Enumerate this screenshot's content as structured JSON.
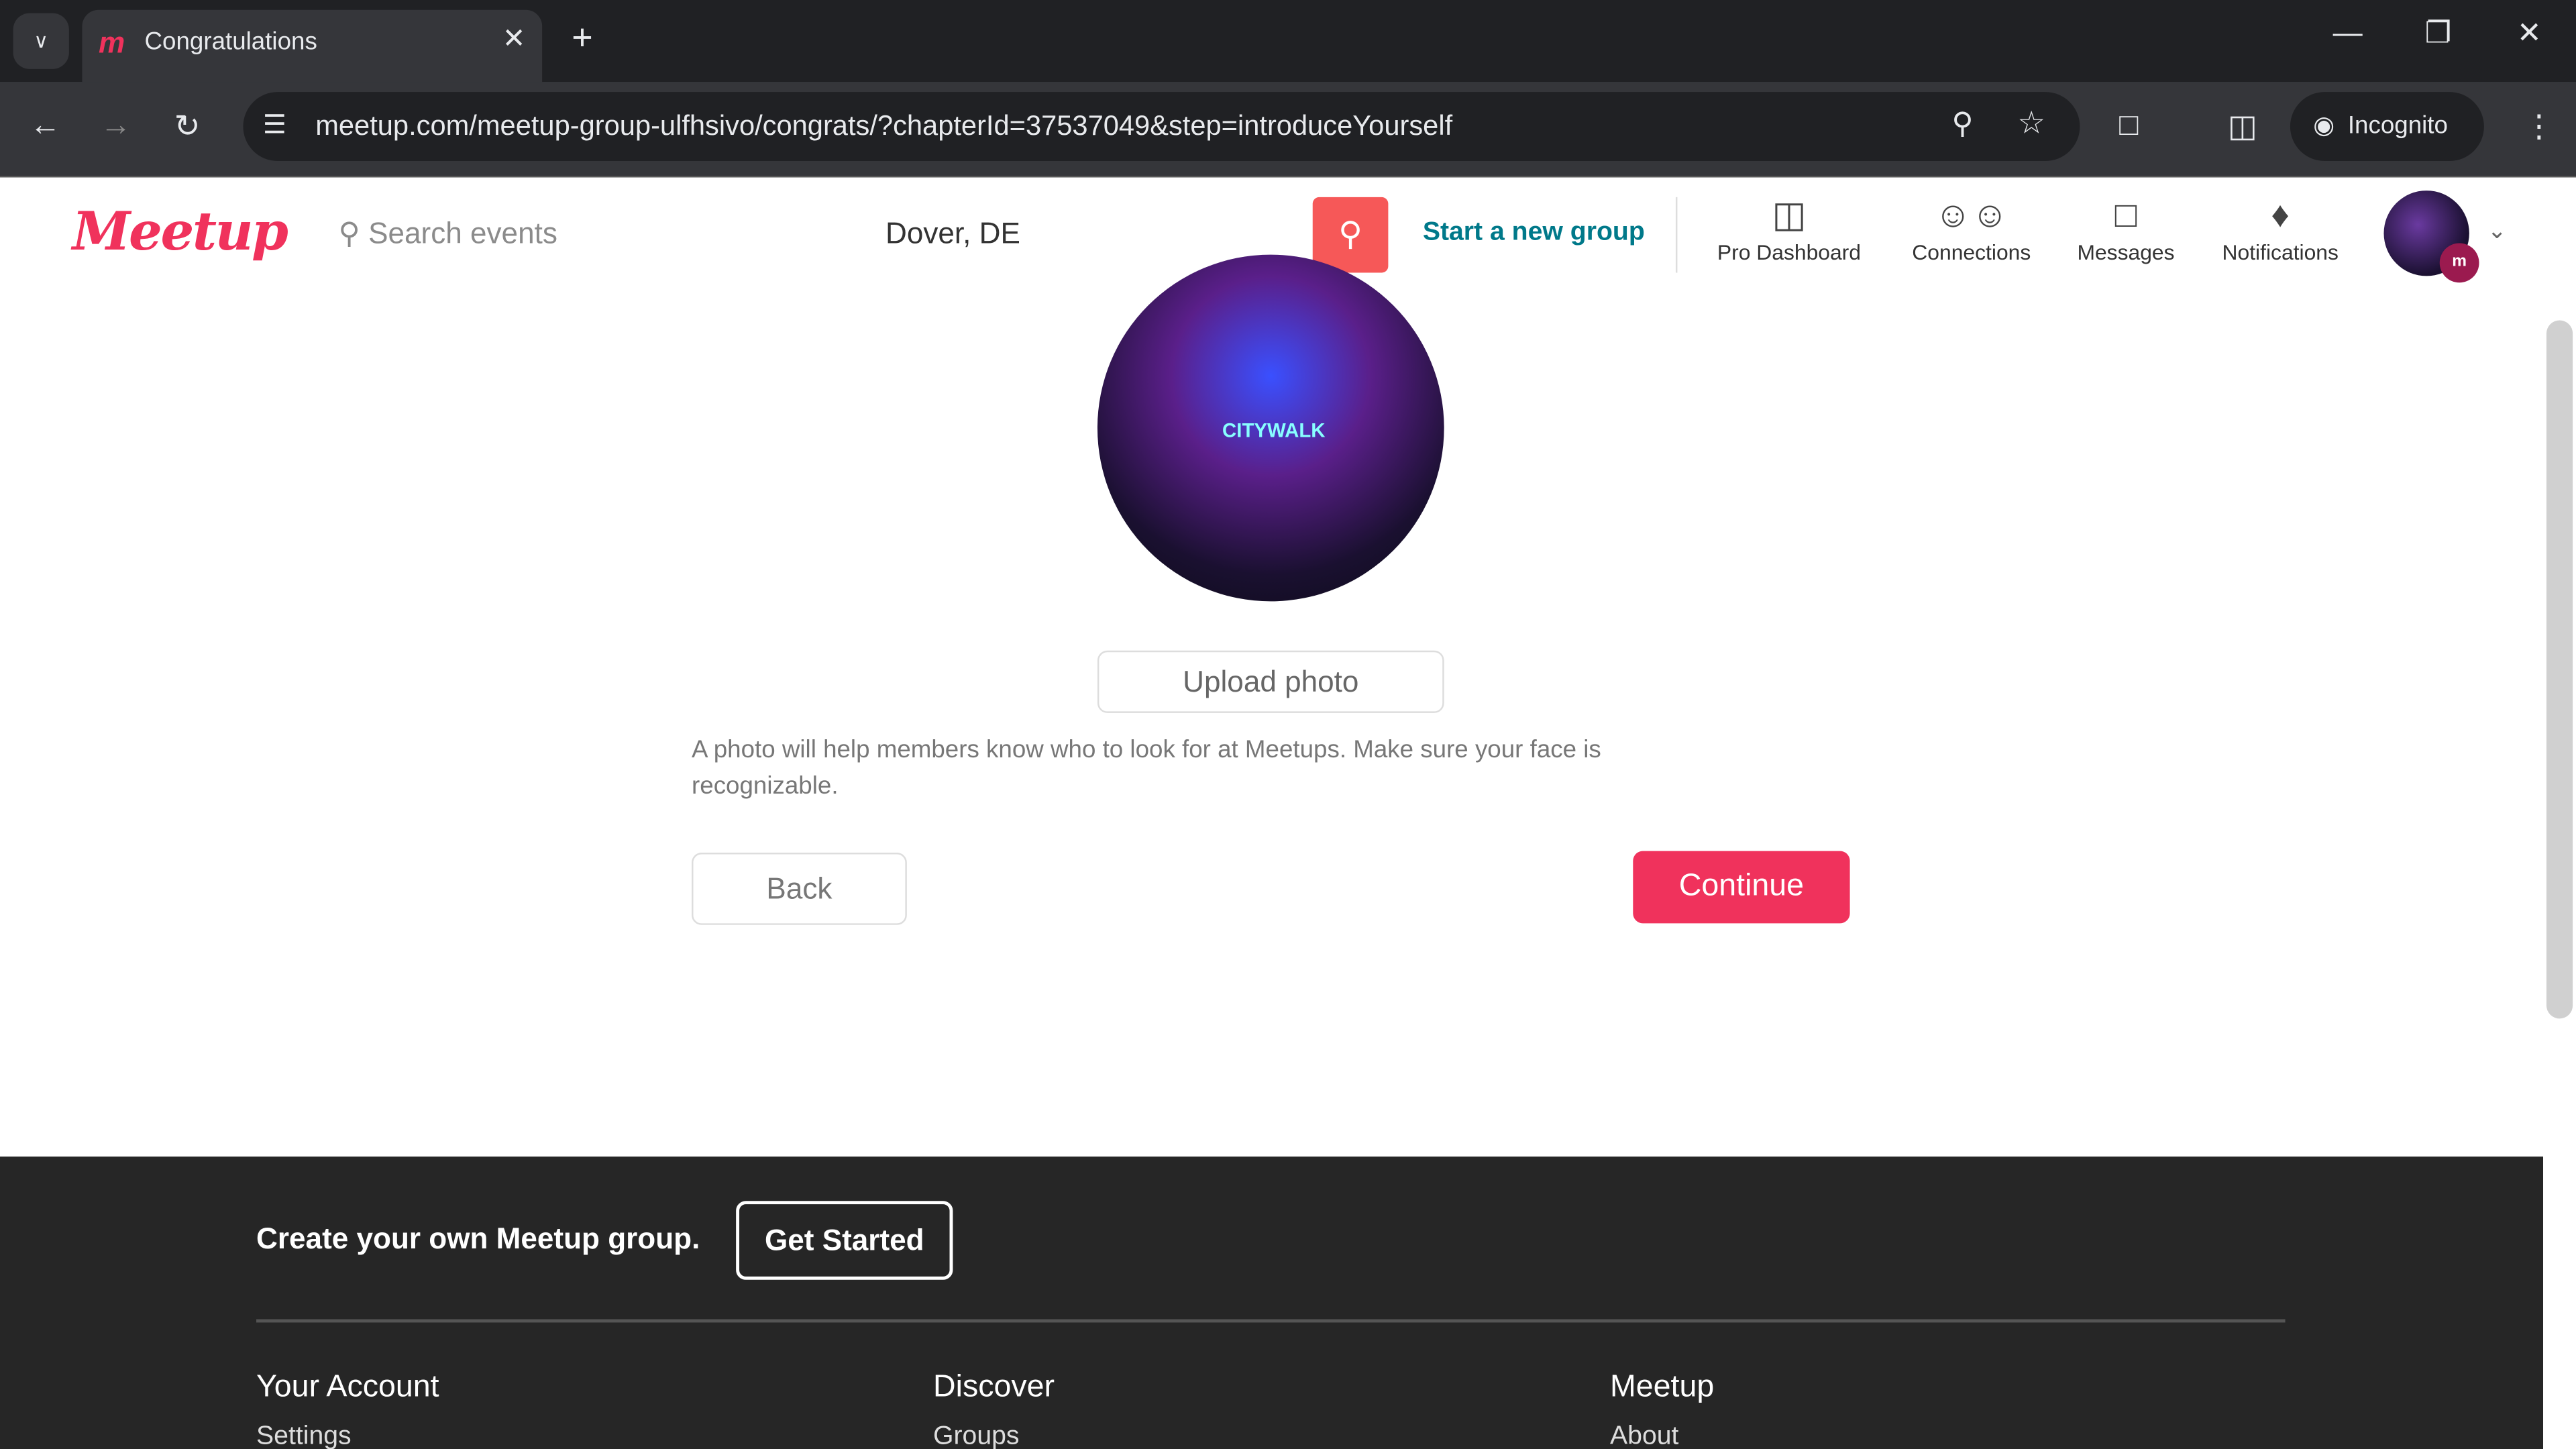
{
  "browser": {
    "tab_title": "Congratulations",
    "url": "meetup.com/meetup-group-ulfhsivo/congrats/?chapterId=37537049&step=introduceYourself",
    "incognito_label": "Incognito"
  },
  "header": {
    "logo": "Meetup",
    "search_placeholder": "Search events",
    "location": "Dover, DE",
    "start_group": "Start a new group",
    "nav": [
      {
        "label": "Pro Dashboard",
        "icon": "bar-chart-icon"
      },
      {
        "label": "Connections",
        "icon": "people-icon"
      },
      {
        "label": "Messages",
        "icon": "chat-icon"
      },
      {
        "label": "Notifications",
        "icon": "bell-icon"
      }
    ]
  },
  "main": {
    "photo_sign": "CITYWALK",
    "upload_label": "Upload photo",
    "help_text": "A photo will help members know who to look for at Meetups. Make sure your face is recognizable.",
    "back_label": "Back",
    "continue_label": "Continue"
  },
  "footer": {
    "cta": "Create your own Meetup group.",
    "get_started": "Get Started",
    "columns": [
      {
        "heading": "Your Account",
        "first_link": "Settings"
      },
      {
        "heading": "Discover",
        "first_link": "Groups"
      },
      {
        "heading": "Meetup",
        "first_link": "About"
      }
    ]
  },
  "colors": {
    "brand": "#f0325c",
    "teal": "#00798a",
    "search_button": "#f65858",
    "footer_bg": "#262626"
  }
}
